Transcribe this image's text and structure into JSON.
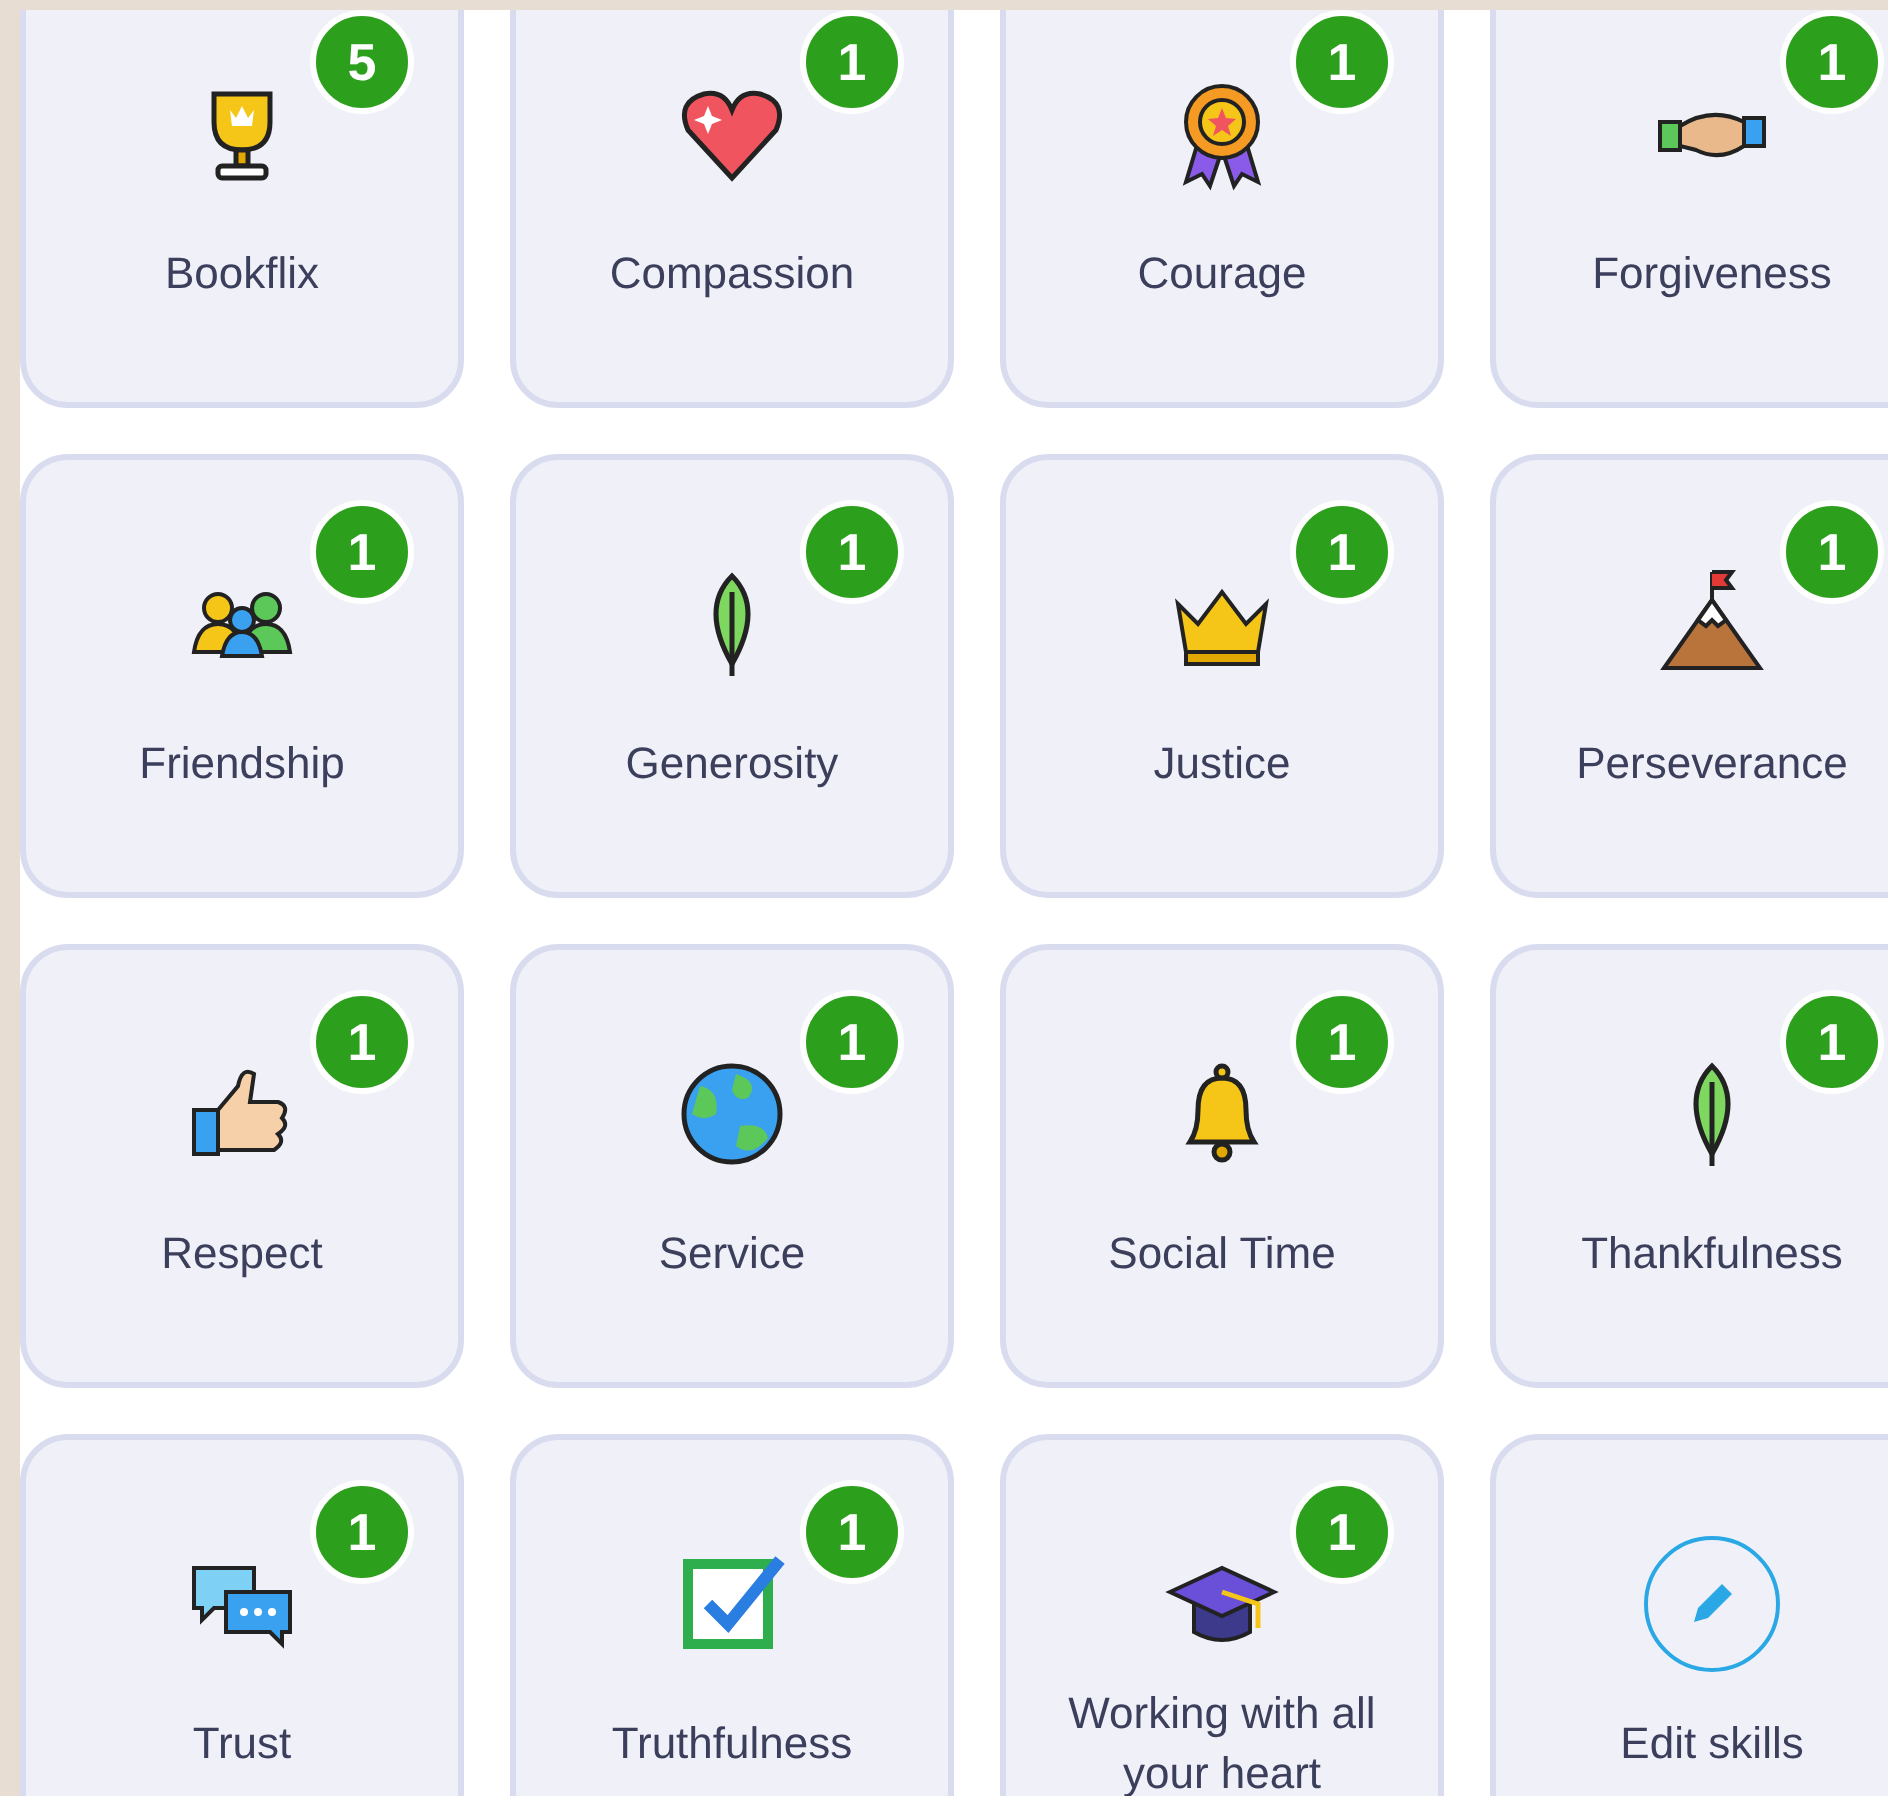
{
  "skills": [
    {
      "label": "Bookflix",
      "count": "5",
      "kind": "skill"
    },
    {
      "label": "Compassion",
      "count": "1",
      "kind": "skill"
    },
    {
      "label": "Courage",
      "count": "1",
      "kind": "skill"
    },
    {
      "label": "Forgiveness",
      "count": "1",
      "kind": "skill"
    },
    {
      "label": "Friendship",
      "count": "1",
      "kind": "skill"
    },
    {
      "label": "Generosity",
      "count": "1",
      "kind": "skill"
    },
    {
      "label": "Justice",
      "count": "1",
      "kind": "skill"
    },
    {
      "label": "Perseverance",
      "count": "1",
      "kind": "skill"
    },
    {
      "label": "Respect",
      "count": "1",
      "kind": "skill"
    },
    {
      "label": "Service",
      "count": "1",
      "kind": "skill"
    },
    {
      "label": "Social Time",
      "count": "1",
      "kind": "skill"
    },
    {
      "label": "Thankfulness",
      "count": "1",
      "kind": "skill"
    },
    {
      "label": "Trust",
      "count": "1",
      "kind": "skill"
    },
    {
      "label": "Truthfulness",
      "count": "1",
      "kind": "skill"
    },
    {
      "label": "Working with all your heart",
      "count": "1",
      "kind": "skill"
    },
    {
      "label": "Edit skills",
      "kind": "edit"
    }
  ]
}
